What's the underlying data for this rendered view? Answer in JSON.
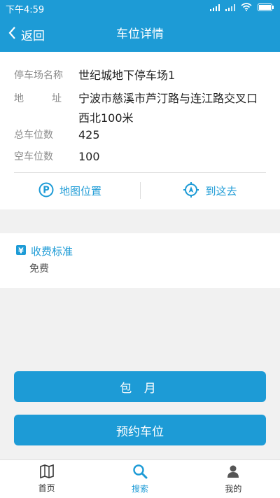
{
  "status": {
    "time": "下午4:59"
  },
  "nav": {
    "back_label": "返回",
    "title": "车位详情"
  },
  "info": {
    "name_label": "停车场名称",
    "name_value": "世纪城地下停车场1",
    "address_label_1": "地",
    "address_label_2": "址",
    "address_value": "宁波市慈溪市芦汀路与连江路交叉口西北100米",
    "total_label": "总车位数",
    "total_value": "425",
    "free_label": "空车位数",
    "free_value": "100"
  },
  "actions": {
    "map_label": "地图位置",
    "go_label": "到这去"
  },
  "fee": {
    "title": "收费标准",
    "value": "免费"
  },
  "buttons": {
    "monthly": "包 月",
    "reserve": "预约车位"
  },
  "tabs": [
    {
      "label": "首页",
      "icon": "map-icon"
    },
    {
      "label": "搜索",
      "icon": "search-icon"
    },
    {
      "label": "我的",
      "icon": "user-icon"
    }
  ],
  "colors": {
    "primary": "#1d9bd6",
    "background": "#f1f1f1"
  }
}
